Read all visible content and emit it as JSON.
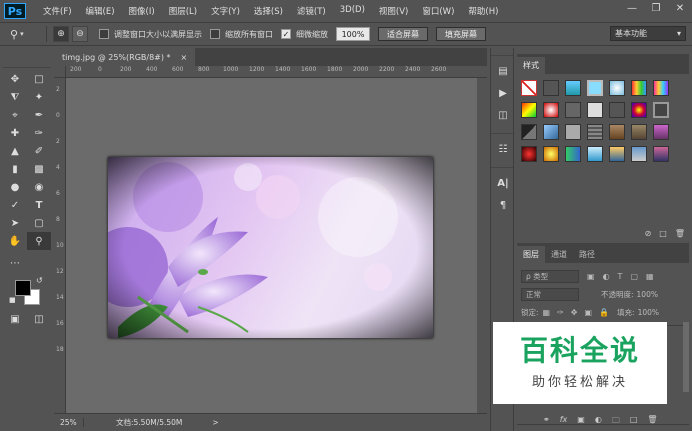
{
  "app": {
    "logo": "Ps"
  },
  "menu": [
    "文件(F)",
    "编辑(E)",
    "图像(I)",
    "图层(L)",
    "文字(Y)",
    "选择(S)",
    "滤镜(T)",
    "3D(D)",
    "视图(V)",
    "窗口(W)",
    "帮助(H)"
  ],
  "window_controls": {
    "minimize": "—",
    "restore": "❐",
    "close": "✕"
  },
  "options": {
    "resize_windows_label": "调整窗口大小以满屏显示",
    "resize_windows_checked": false,
    "zoom_all_label": "缩放所有窗口",
    "zoom_all_checked": false,
    "scrubby_label": "细微缩放",
    "scrubby_checked": true,
    "zoom_value": "100%",
    "fit_screen": "适合屏幕",
    "fill_screen": "填充屏幕",
    "workspace": "基本功能"
  },
  "document": {
    "tab_title": "timg.jpg @ 25%(RGB/8#) *",
    "tab_close": "×",
    "status_zoom": "25%",
    "status_doc": "文档:5.50M/5.50M",
    "status_arrow": ">",
    "ruler_h": [
      "200",
      "0",
      "200",
      "400",
      "600",
      "800",
      "1000",
      "1200",
      "1400",
      "1600",
      "1800",
      "2000",
      "2200",
      "2400",
      "2600"
    ],
    "ruler_v": [
      "2",
      "0",
      "2",
      "4",
      "6",
      "8",
      "10",
      "12",
      "14",
      "16",
      "18"
    ]
  },
  "styles_panel": {
    "tab": "样式"
  },
  "layers_panel": {
    "tabs": [
      "图层",
      "通道",
      "路径"
    ],
    "filter_kind": "ρ 类型",
    "blend_mode": "正常",
    "opacity_label": "不透明度:",
    "opacity_value": "100%",
    "lock_label": "锁定:",
    "fill_label": "填充:",
    "fill_value": "100%"
  },
  "watermark": {
    "title": "百科全说",
    "subtitle": "助你轻松解决"
  },
  "colors": {
    "accent": "#31a8ff",
    "watermark_green": "#1aa35e"
  }
}
